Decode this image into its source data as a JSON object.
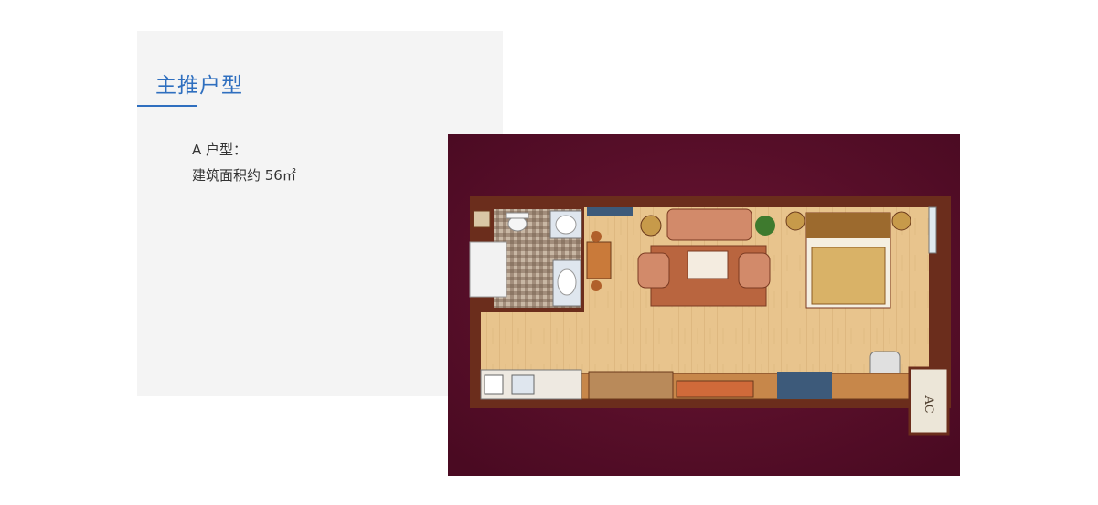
{
  "section": {
    "title": "主推户型",
    "unit_name": "A 户型：",
    "area_line": "建筑面积约 56㎡"
  },
  "floor_plan": {
    "image_description_icon": "floor-plan-image",
    "ac_label": "AC",
    "colors": {
      "accent": "#2f6fbf",
      "background_maroon": "#5e0d2b",
      "wall": "#6b2d1c",
      "floor": "#e6c088"
    }
  }
}
